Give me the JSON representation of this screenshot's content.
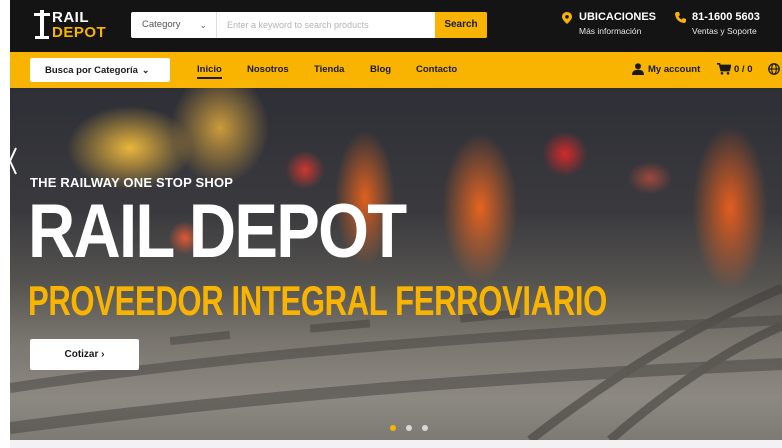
{
  "logo": {
    "line1": "RAIL",
    "line2": "DEPOT"
  },
  "search": {
    "category_label": "Category",
    "placeholder": "Enter a keyword to search products",
    "button_label": "Search"
  },
  "header": {
    "locations": {
      "title": "UBICACIONES",
      "subtitle": "Más información"
    },
    "phone": {
      "title": "81-1600 5603",
      "subtitle": "Ventas y Soporte"
    }
  },
  "nav": {
    "browse_label": "Busca por Categoría",
    "links": [
      {
        "label": "Inicio",
        "active": true
      },
      {
        "label": "Nosotros"
      },
      {
        "label": "Tienda"
      },
      {
        "label": "Blog"
      },
      {
        "label": "Contacto"
      }
    ],
    "account_label": "My account",
    "cart_label": "0 / 0"
  },
  "hero": {
    "subtitle": "THE RAILWAY ONE STOP SHOP",
    "title": "RAIL DEPOT",
    "tagline": "PROVEEDOR INTEGRAL FERROVIARIO",
    "cta_label": "Cotizar",
    "slides": 3,
    "active_slide": 1
  },
  "colors": {
    "accent": "#f8b400",
    "dark": "#141414",
    "white": "#ffffff"
  },
  "icons": [
    "logo-mark-icon",
    "chevron-down-icon",
    "location-pin-icon",
    "phone-icon",
    "user-icon",
    "cart-icon",
    "globe-icon",
    "chevron-right-icon",
    "slider-prev-icon"
  ]
}
